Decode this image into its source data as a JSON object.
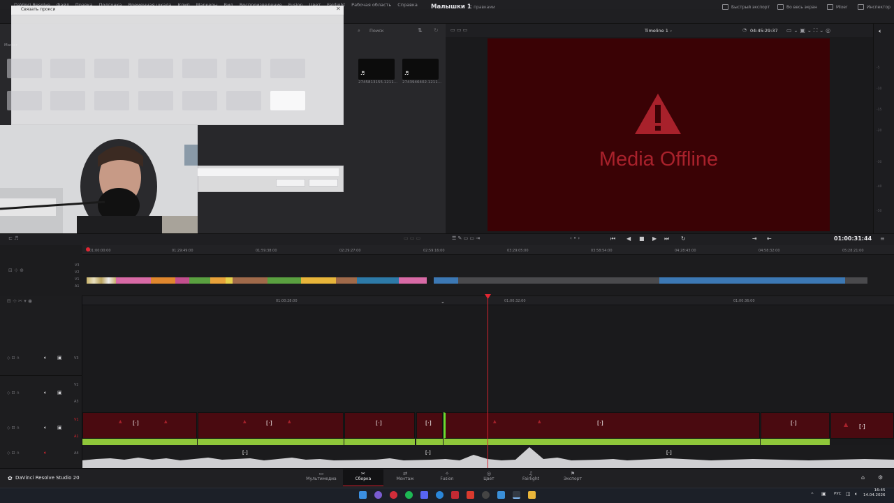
{
  "menu": {
    "items": [
      "DaVinci Resolve",
      "Файл",
      "Правка",
      "Подгонка",
      "Временная шкала",
      "Клип",
      "Маркеры",
      "Вид",
      "Воспроизведение",
      "Fusion",
      "Цвет",
      "Fairlight",
      "Рабочая область",
      "Справка"
    ]
  },
  "toolbar": {
    "project_title": "Малышки 1",
    "project_subtitle": "С правками",
    "quick_export": "Быстрый экспорт",
    "fullscreen": "Во весь экран",
    "mixer": "Mixer",
    "inspector": "Инспектор"
  },
  "media_pool": {
    "label": "Master",
    "search_placeholder": "Поиск",
    "visible_clips": [
      {
        "name": "2745813155.1211..."
      },
      {
        "name": "2743946402.1211..."
      }
    ]
  },
  "dialog": {
    "title": "Связать прокси"
  },
  "viewer": {
    "timeline_name": "Timeline 1",
    "timecode_top": "04:45:29:37",
    "offline_text": "Media Offline",
    "meter_ticks": [
      "-5",
      "-10",
      "-15",
      "-20",
      "-30",
      "-40",
      "-50"
    ]
  },
  "transport": {
    "timecode": "01:00:31:44"
  },
  "upper_ruler": [
    "01:00:00:00",
    "01:29:49:00",
    "01:59:38:00",
    "02:29:27:00",
    "02:59:16:00",
    "03:29:05:00",
    "03:58:54:00",
    "04:28:43:00",
    "04:58:32:00",
    "05:28:21:00"
  ],
  "lower_ruler": [
    "01:00:28:00",
    "01:00:32:00",
    "01:00:36:00"
  ],
  "tracks": {
    "v3": "V3",
    "v2": "V2",
    "a3": "A3",
    "v1": "V1",
    "a1": "A1",
    "a4": "A4"
  },
  "pages": {
    "brand": "DaVinci Resolve Studio 20",
    "items": [
      "Мультимедиа",
      "Сборка",
      "Монтаж",
      "Fusion",
      "Цвет",
      "Fairlight",
      "Экспорт"
    ],
    "active_index": 1
  },
  "system": {
    "lang": "РУС",
    "time": "16:45",
    "date": "14.04.2026"
  },
  "colors": {
    "accent": "#d41c2c",
    "offline_bg": "#3a0205",
    "offline_text": "#a8212b",
    "clip_green": "#8fc73a"
  }
}
